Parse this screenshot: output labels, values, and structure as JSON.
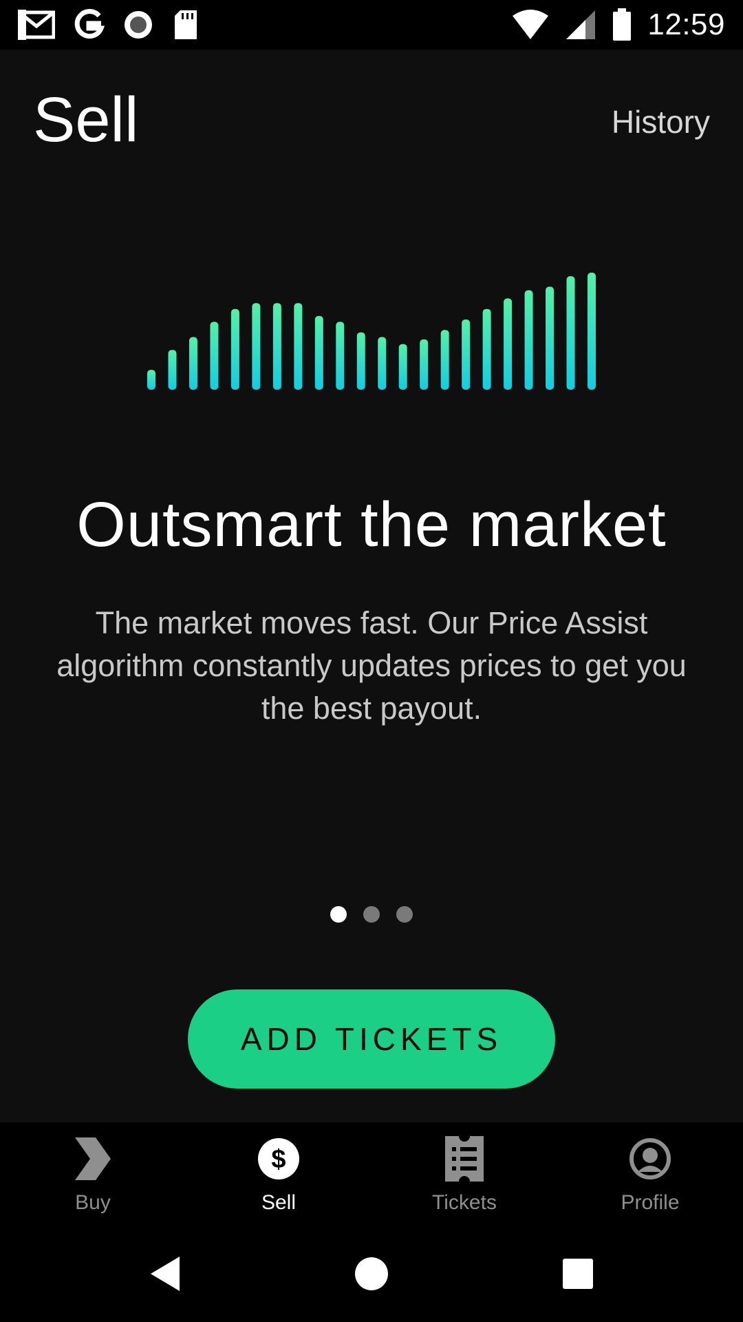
{
  "status_bar": {
    "time": "12:59",
    "left_icons": [
      "gmail-icon",
      "google-icon",
      "record-icon",
      "sd-card-icon"
    ],
    "right_icons": [
      "wifi-icon",
      "cell-signal-icon",
      "battery-icon"
    ]
  },
  "header": {
    "title": "Sell",
    "history_label": "History"
  },
  "hero": {
    "chart_icon": "bar-visualization-icon",
    "gradient_top": "#54f0a8",
    "gradient_bottom": "#13cde0",
    "bar_levels": [
      0.17,
      0.34,
      0.45,
      0.58,
      0.69,
      0.74,
      0.74,
      0.74,
      0.63,
      0.58,
      0.49,
      0.45,
      0.39,
      0.43,
      0.51,
      0.6,
      0.69,
      0.78,
      0.85,
      0.88,
      0.97,
      1.0
    ]
  },
  "headline": "Outsmart the market",
  "description": "The market moves fast. Our Price Assist algorithm constantly updates prices to get you the best payout.",
  "pager": {
    "count": 3,
    "active_index": 0
  },
  "cta": {
    "label": "ADD TICKETS",
    "color": "#1bcf87"
  },
  "bottom_nav": {
    "items": [
      {
        "label": "Buy",
        "icon": "buy-chevron-icon"
      },
      {
        "label": "Sell",
        "icon": "dollar-icon"
      },
      {
        "label": "Tickets",
        "icon": "ticket-icon"
      },
      {
        "label": "Profile",
        "icon": "profile-icon"
      }
    ],
    "active_index": 1
  },
  "system_nav": [
    "back-icon",
    "home-icon",
    "recents-icon"
  ]
}
